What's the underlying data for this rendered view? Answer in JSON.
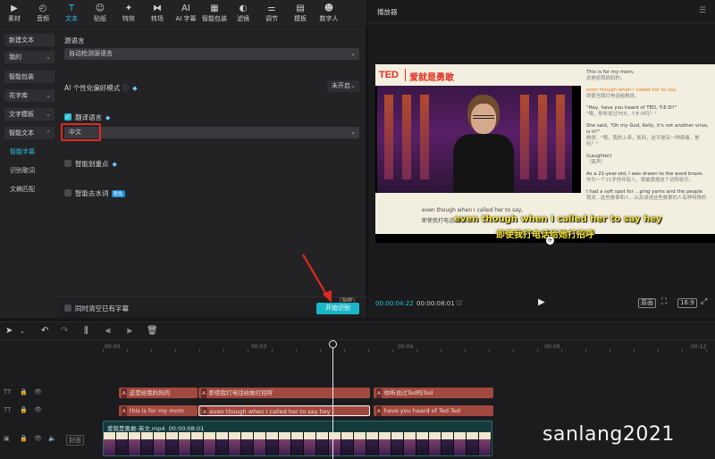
{
  "toolbar": {
    "items": [
      {
        "label": "素材",
        "icon": "media-icon"
      },
      {
        "label": "音频",
        "icon": "audio-icon"
      },
      {
        "label": "文本",
        "icon": "text-icon"
      },
      {
        "label": "贴纸",
        "icon": "sticker-icon"
      },
      {
        "label": "特效",
        "icon": "effects-icon"
      },
      {
        "label": "转场",
        "icon": "transition-icon"
      },
      {
        "label": "AI 字幕",
        "icon": "ai-caption-icon"
      },
      {
        "label": "智能包装",
        "icon": "smart-package-icon"
      },
      {
        "label": "滤镜",
        "icon": "filter-icon"
      },
      {
        "label": "调节",
        "icon": "adjust-icon"
      },
      {
        "label": "模板",
        "icon": "template-icon"
      },
      {
        "label": "数字人",
        "icon": "avatar-icon"
      }
    ],
    "active_index": 2,
    "accent_color": "#27c2d6"
  },
  "side_nav": {
    "new_text": "新建文本",
    "mine": "我的",
    "smart_package": "智能包装",
    "fancy_text": "花字库",
    "text_template": "文字模板",
    "smart_text": "智能文本",
    "smart_caption": "智能字幕",
    "lyric_recognition": "识别歌词",
    "text_match": "文稿匹配"
  },
  "content": {
    "source_language_label": "源语言",
    "source_language_value": "自动检测源语言",
    "ai_preference_label": "AI 个性化偏好模式",
    "ai_preference_value": "未开启",
    "translate_label": "翻译语言",
    "translate_checked": true,
    "translate_value": "中文",
    "smart_split_label": "智能划重点",
    "smart_filler_label": "智能去水词",
    "free_badge": "限免",
    "clear_existing_label": "同时清空已有字幕",
    "start_button": "开始识别",
    "svip_badge": "SVIP"
  },
  "player": {
    "title": "播放器",
    "video": {
      "logo": "TED",
      "episode_title": "爱就是勇敢",
      "small_sub_en": "even though when I called her to say,",
      "small_sub_cn": "即使我打电话给她，",
      "big_sub_en": "even though when I called her to say hey",
      "big_sub_cn": "即使我打电话给她打招呼",
      "transcript": [
        {
          "en": "This is for my mom,",
          "cn": "这是给我妈妈的，",
          "highlight": false
        },
        {
          "en": "even though when I called her to say,",
          "cn": "即使当我打电话给她说，",
          "highlight": true
        },
        {
          "en": "\"Hey, have you heard of TED, T-E-D?\"",
          "cn": "\"嘿，你听说过TED，T-E-D吗？\"",
          "highlight": false
        },
        {
          "en": "She said, \"Oh my God, Kelly, it's not another virus, is it?\"",
          "cn": "她说：\"哦，我的上帝，凯利，这不是另一种病毒，是吗？\"",
          "highlight": false
        },
        {
          "en": "(Laughter)",
          "cn": "（笑声）",
          "highlight": false
        },
        {
          "en": "As a 21-year-old, I was drawn to the word brave.",
          "cn": "作为一个21岁的年轻人，我被勇敢这个词所吸引。",
          "highlight": false
        },
        {
          "en": "I had a soft spot for ...ping yarns and the people",
          "cn": "我对...这些故事和人...以及讲述这些故事的人有种特殊的",
          "highlight": false
        }
      ]
    },
    "time_current": "00:00:04:22",
    "time_total": "00:00:08:01",
    "ratio_button": "16:9",
    "original_button": "原画"
  },
  "timeline": {
    "ruler": [
      "00:00",
      "00:03",
      "00:06",
      "00:09",
      "00:12"
    ],
    "cn_clips": [
      {
        "label": "这是给我妈妈的"
      },
      {
        "label": "即使我打电话给她打招呼"
      },
      {
        "label": "你听说过Ted吗Ted"
      }
    ],
    "en_clips": [
      {
        "label": "this is for my mom",
        "selected": false
      },
      {
        "label": "even though when I called her to say hey",
        "selected": true
      },
      {
        "label": "have you heard of Ted Ted",
        "selected": false
      }
    ],
    "clip_badge": "A",
    "video_clip_name": "爱就是勇敢-英文.mp4",
    "video_clip_duration": "00:00:08:01"
  },
  "watermark": "sanlang2021"
}
